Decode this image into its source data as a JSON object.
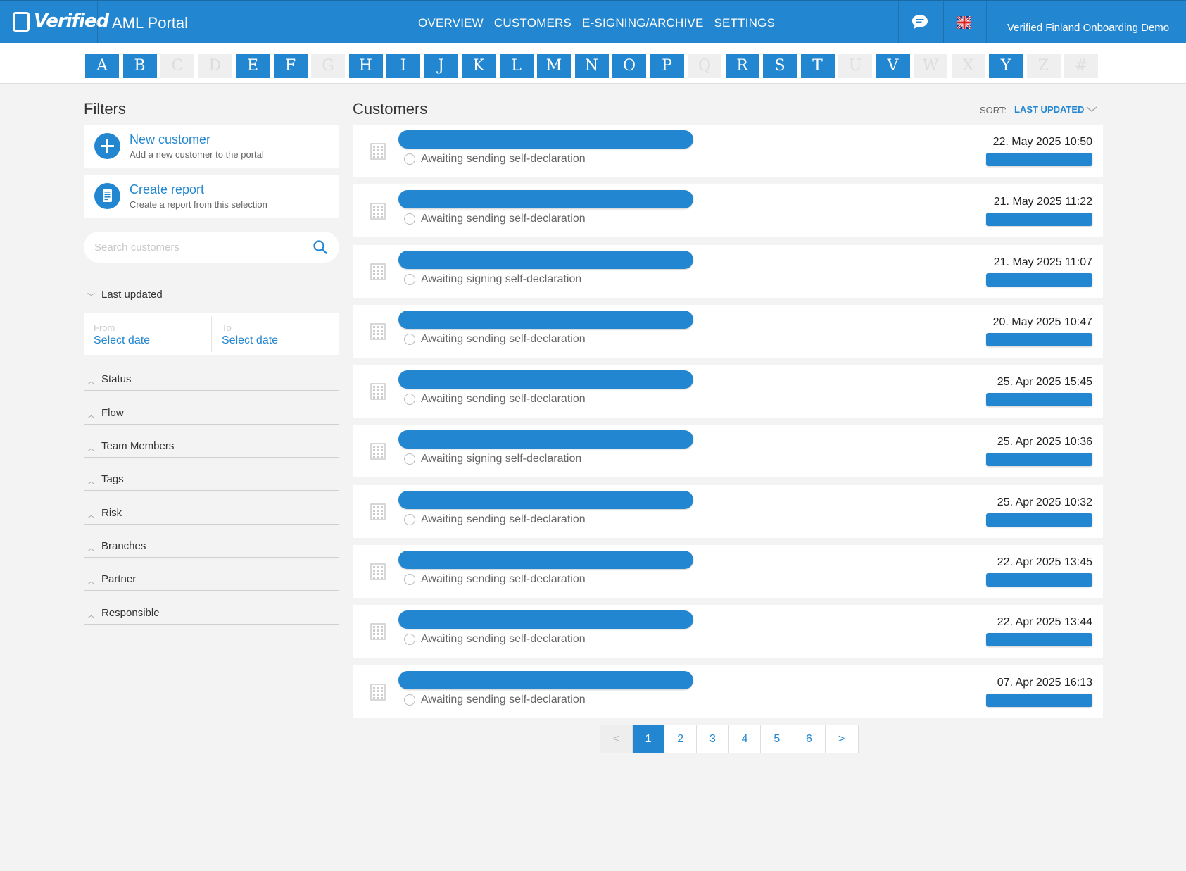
{
  "header": {
    "logo_text": "Verified",
    "app_title": "AML Portal",
    "nav": [
      "OVERVIEW",
      "CUSTOMERS",
      "E-SIGNING/ARCHIVE",
      "SETTINGS"
    ],
    "account": "Verified Finland Onboarding Demo",
    "chat_icon": "chat-bubble-icon",
    "language_icon": "uk-flag-icon"
  },
  "alphabet": [
    {
      "letter": "A",
      "enabled": true
    },
    {
      "letter": "B",
      "enabled": true
    },
    {
      "letter": "C",
      "enabled": false
    },
    {
      "letter": "D",
      "enabled": false
    },
    {
      "letter": "E",
      "enabled": true
    },
    {
      "letter": "F",
      "enabled": true
    },
    {
      "letter": "G",
      "enabled": false
    },
    {
      "letter": "H",
      "enabled": true
    },
    {
      "letter": "I",
      "enabled": true
    },
    {
      "letter": "J",
      "enabled": true
    },
    {
      "letter": "K",
      "enabled": true
    },
    {
      "letter": "L",
      "enabled": true
    },
    {
      "letter": "M",
      "enabled": true
    },
    {
      "letter": "N",
      "enabled": true
    },
    {
      "letter": "O",
      "enabled": true
    },
    {
      "letter": "P",
      "enabled": true
    },
    {
      "letter": "Q",
      "enabled": false
    },
    {
      "letter": "R",
      "enabled": true
    },
    {
      "letter": "S",
      "enabled": true
    },
    {
      "letter": "T",
      "enabled": true
    },
    {
      "letter": "U",
      "enabled": false
    },
    {
      "letter": "V",
      "enabled": true
    },
    {
      "letter": "W",
      "enabled": false
    },
    {
      "letter": "X",
      "enabled": false
    },
    {
      "letter": "Y",
      "enabled": true
    },
    {
      "letter": "Z",
      "enabled": false
    },
    {
      "letter": "#",
      "enabled": false
    }
  ],
  "filters": {
    "title": "Filters",
    "new_customer": {
      "title": "New customer",
      "subtitle": "Add a new customer to the portal"
    },
    "create_report": {
      "title": "Create report",
      "subtitle": "Create a report from this selection"
    },
    "search_placeholder": "Search customers",
    "last_updated": {
      "label": "Last updated",
      "from_label": "From",
      "from_value": "Select date",
      "to_label": "To",
      "to_value": "Select date"
    },
    "sections": [
      "Status",
      "Flow",
      "Team Members",
      "Tags",
      "Risk",
      "Branches",
      "Partner",
      "Responsible"
    ]
  },
  "customers": {
    "title": "Customers",
    "sort_label": "SORT:",
    "sort_value": "LAST UPDATED",
    "rows": [
      {
        "status": "Awaiting sending self-declaration",
        "date": "22. May 2025 10:50"
      },
      {
        "status": "Awaiting sending self-declaration",
        "date": "21. May 2025 11:22"
      },
      {
        "status": "Awaiting signing self-declaration",
        "date": "21. May 2025 11:07"
      },
      {
        "status": "Awaiting sending self-declaration",
        "date": "20. May 2025 10:47"
      },
      {
        "status": "Awaiting sending self-declaration",
        "date": "25. Apr 2025 15:45"
      },
      {
        "status": "Awaiting signing self-declaration",
        "date": "25. Apr 2025 10:36"
      },
      {
        "status": "Awaiting sending self-declaration",
        "date": "25. Apr 2025 10:32"
      },
      {
        "status": "Awaiting sending self-declaration",
        "date": "22. Apr 2025 13:45"
      },
      {
        "status": "Awaiting sending self-declaration",
        "date": "22. Apr 2025 13:44"
      },
      {
        "status": "Awaiting sending self-declaration",
        "date": "07. Apr 2025 16:13"
      }
    ]
  },
  "pagination": {
    "prev": "<",
    "pages": [
      "1",
      "2",
      "3",
      "4",
      "5",
      "6"
    ],
    "current": "1",
    "next": ">"
  },
  "colors": {
    "accent": "#2386d0",
    "background": "#f3f3f3"
  }
}
